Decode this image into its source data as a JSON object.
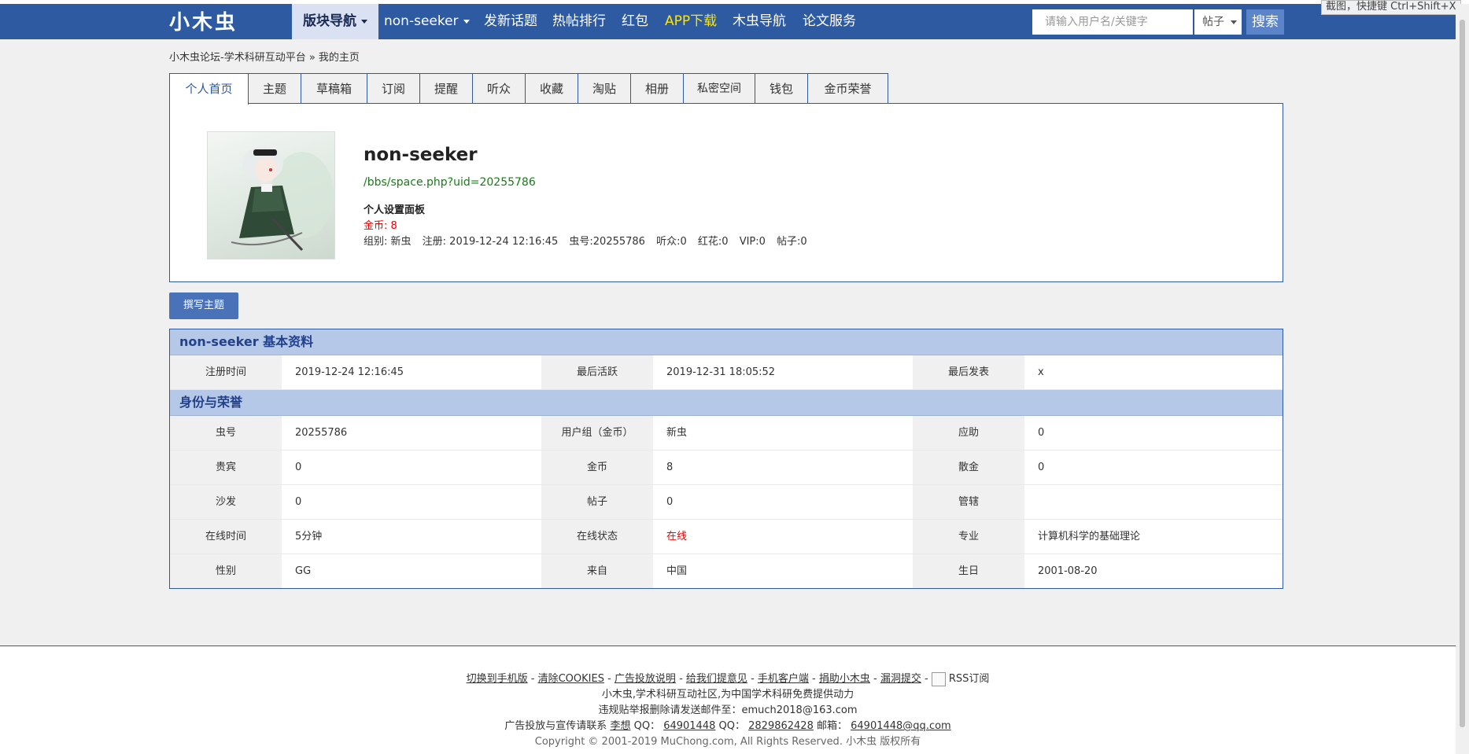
{
  "nav": {
    "logo": "小木虫",
    "items": [
      {
        "label": "版块导航",
        "active": true,
        "caret": true
      },
      {
        "label": "non-seeker",
        "caret": true
      },
      {
        "label": "发新话题"
      },
      {
        "label": "热帖排行"
      },
      {
        "label": "红包"
      },
      {
        "label": "APP下载",
        "highlight": true
      },
      {
        "label": "木虫导航"
      },
      {
        "label": "论文服务"
      }
    ],
    "search_placeholder": "请输入用户名/关键字",
    "search_type": "帖子",
    "search_button": "搜索",
    "hint": "截图，快捷键 Ctrl+Shift+X"
  },
  "breadcrumb": "小木虫论坛-学术科研互动平台 » 我的主页",
  "tabs": [
    "个人首页",
    "主题",
    "草稿箱",
    "订阅",
    "提醒",
    "听众",
    "收藏",
    "淘贴",
    "相册",
    "私密空间",
    "钱包",
    "金币荣誉"
  ],
  "profile": {
    "name": "non-seeker",
    "link": "/bbs/space.php?uid=20255786",
    "settings": "个人设置面板",
    "coins": "金币: 8",
    "stats": [
      "组别: 新虫",
      "注册: 2019-12-24 12:16:45",
      "虫号:20255786",
      "听众:0",
      "红花:0",
      "VIP:0",
      "帖子:0"
    ]
  },
  "write_button": "撰写主题",
  "basic_section": {
    "title": "non-seeker 基本资料",
    "rows": [
      [
        [
          "注册时间",
          "2019-12-24 12:16:45"
        ],
        [
          "最后活跃",
          "2019-12-31 18:05:52"
        ],
        [
          "最后发表",
          "x"
        ]
      ]
    ]
  },
  "honor_section": {
    "title": "身份与荣誉",
    "rows": [
      [
        [
          "虫号",
          "20255786"
        ],
        [
          "用户组（金币）",
          "新虫"
        ],
        [
          "应助",
          "0"
        ]
      ],
      [
        [
          "贵宾",
          "0"
        ],
        [
          "金币",
          "8"
        ],
        [
          "散金",
          "0"
        ]
      ],
      [
        [
          "沙发",
          "0"
        ],
        [
          "帖子",
          "0"
        ],
        [
          "管辖",
          ""
        ]
      ],
      [
        [
          "在线时间",
          "5分钟"
        ],
        [
          "在线状态",
          "在线"
        ],
        [
          "专业",
          "计算机科学的基础理论"
        ]
      ],
      [
        [
          "性别",
          "GG"
        ],
        [
          "来自",
          "中国"
        ],
        [
          "生日",
          "2001-08-20"
        ]
      ]
    ]
  },
  "footer": {
    "links": [
      "切换到手机版",
      "清除COOKIES",
      "广告投放说明",
      "给我们提意见",
      "手机客户端",
      "捐助小木虫",
      "漏洞提交"
    ],
    "rss": "RSS订阅",
    "line2": "小木虫,学术科研互动社区,为中国学术科研免费提供动力",
    "line3": "违规贴举报删除请发送邮件至：emuch2018@163.com",
    "line4_prefix": "广告投放与宣传请联系",
    "contact_name": "李想",
    "qq_label": "QQ：",
    "qq1": "64901448",
    "qq2": "2829862428",
    "mail_label": "邮箱：",
    "mail": "64901448@qq.com",
    "copyright": "Copyright © 2001-2019 MuChong.com, All Rights Reserved. 小木虫 版权所有"
  },
  "colors": {
    "nav_bg": "#2e5aa2",
    "section_header": "#b5c8e8",
    "online": "#e00",
    "link_green": "#1c7a1c"
  }
}
